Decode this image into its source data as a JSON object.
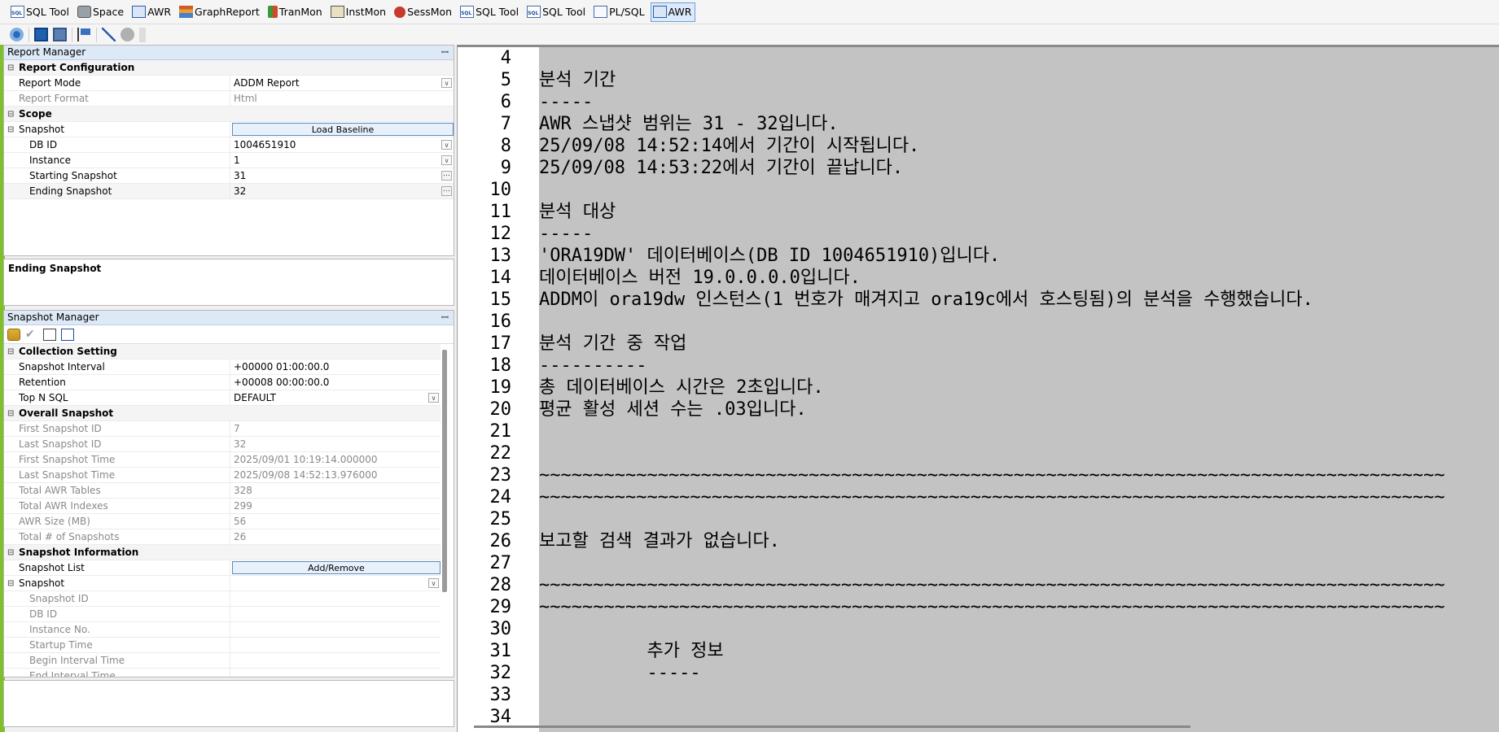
{
  "tabs": [
    {
      "label": "SQL Tool",
      "icon": "sql-tool-icon",
      "cls": "ti-sql"
    },
    {
      "label": "Space",
      "icon": "space-icon",
      "cls": "ti-space"
    },
    {
      "label": "AWR",
      "icon": "awr-icon",
      "cls": "ti-awr"
    },
    {
      "label": "GraphReport",
      "icon": "graph-report-icon",
      "cls": "ti-graph"
    },
    {
      "label": "TranMon",
      "icon": "tranmon-icon",
      "cls": "ti-tran"
    },
    {
      "label": "InstMon",
      "icon": "instmon-icon",
      "cls": "ti-inst"
    },
    {
      "label": "SessMon",
      "icon": "sessmon-icon",
      "cls": "ti-sess"
    },
    {
      "label": "SQL Tool",
      "icon": "sql-tool-icon",
      "cls": "ti-sql"
    },
    {
      "label": "SQL Tool",
      "icon": "sql-tool-icon",
      "cls": "ti-sql"
    },
    {
      "label": "PL/SQL",
      "icon": "plsql-icon",
      "cls": "ti-plsql"
    },
    {
      "label": "AWR",
      "icon": "awr-icon",
      "cls": "ti-awr",
      "active": true
    }
  ],
  "report_manager": {
    "title": "Report Manager",
    "config_section": "Report Configuration",
    "report_mode_label": "Report Mode",
    "report_mode_value": "ADDM Report",
    "report_format_label": "Report Format",
    "report_format_value": "Html",
    "scope_section": "Scope",
    "snapshot_label": "Snapshot",
    "load_baseline_label": "Load Baseline",
    "dbid_label": "DB ID",
    "dbid_value": "1004651910",
    "instance_label": "Instance",
    "instance_value": "1",
    "start_label": "Starting Snapshot",
    "start_value": "31",
    "end_label": "Ending Snapshot",
    "end_value": "32",
    "description_title": "Ending Snapshot"
  },
  "snapshot_manager": {
    "title": "Snapshot Manager",
    "collection_section": "Collection Setting",
    "interval_label": "Snapshot Interval",
    "interval_value": "+00000 01:00:00.0",
    "retention_label": "Retention",
    "retention_value": "+00008 00:00:00.0",
    "topn_label": "Top N SQL",
    "topn_value": "DEFAULT",
    "overall_section": "Overall Snapshot",
    "overall_rows": [
      {
        "label": "First Snapshot ID",
        "value": "7"
      },
      {
        "label": "Last Snapshot ID",
        "value": "32"
      },
      {
        "label": "First Snapshot Time",
        "value": "2025/09/01 10:19:14.000000"
      },
      {
        "label": "Last Snapshot Time",
        "value": "2025/09/08 14:52:13.976000"
      },
      {
        "label": "Total AWR Tables",
        "value": "328"
      },
      {
        "label": "Total AWR Indexes",
        "value": "299"
      },
      {
        "label": "AWR Size (MB)",
        "value": "56"
      },
      {
        "label": "Total # of Snapshots",
        "value": "26"
      }
    ],
    "info_section": "Snapshot Information",
    "snapshot_list_label": "Snapshot List",
    "add_remove_label": "Add/Remove",
    "snapshot_label": "Snapshot",
    "snapshot_fields": [
      "Snapshot ID",
      "DB ID",
      "Instance No.",
      "Startup Time",
      "Begin Interval Time",
      "End Interval Time"
    ]
  },
  "report_lines": [
    {
      "n": "4",
      "t": ""
    },
    {
      "n": "5",
      "t": "분석 기간"
    },
    {
      "n": "6",
      "t": "-----"
    },
    {
      "n": "7",
      "t": "AWR 스냅샷 범위는 31 - 32입니다."
    },
    {
      "n": "8",
      "t": "25/09/08 14:52:14에서 기간이 시작됩니다."
    },
    {
      "n": "9",
      "t": "25/09/08 14:53:22에서 기간이 끝납니다."
    },
    {
      "n": "10",
      "t": ""
    },
    {
      "n": "11",
      "t": "분석 대상"
    },
    {
      "n": "12",
      "t": "-----"
    },
    {
      "n": "13",
      "t": "'ORA19DW' 데이터베이스(DB ID 1004651910)입니다."
    },
    {
      "n": "14",
      "t": "데이터베이스 버전 19.0.0.0.0입니다."
    },
    {
      "n": "15",
      "t": "ADDM이 ora19dw 인스턴스(1 번호가 매겨지고 ora19c에서 호스팅됨)의 분석을 수행했습니다."
    },
    {
      "n": "16",
      "t": ""
    },
    {
      "n": "17",
      "t": "분석 기간 중 작업"
    },
    {
      "n": "18",
      "t": "----------"
    },
    {
      "n": "19",
      "t": "총 데이터베이스 시간은 2초입니다."
    },
    {
      "n": "20",
      "t": "평균 활성 세션 수는 .03입니다."
    },
    {
      "n": "21",
      "t": ""
    },
    {
      "n": "22",
      "t": ""
    },
    {
      "n": "23",
      "t": "~~~~~~~~~~~~~~~~~~~~~~~~~~~~~~~~~~~~~~~~~~~~~~~~~~~~~~~~~~~~~~~~~~~~~~~~~~~~~~~~~~~~"
    },
    {
      "n": "24",
      "t": "~~~~~~~~~~~~~~~~~~~~~~~~~~~~~~~~~~~~~~~~~~~~~~~~~~~~~~~~~~~~~~~~~~~~~~~~~~~~~~~~~~~~"
    },
    {
      "n": "25",
      "t": ""
    },
    {
      "n": "26",
      "t": "보고할 검색 결과가 없습니다."
    },
    {
      "n": "27",
      "t": ""
    },
    {
      "n": "28",
      "t": "~~~~~~~~~~~~~~~~~~~~~~~~~~~~~~~~~~~~~~~~~~~~~~~~~~~~~~~~~~~~~~~~~~~~~~~~~~~~~~~~~~~~"
    },
    {
      "n": "29",
      "t": "~~~~~~~~~~~~~~~~~~~~~~~~~~~~~~~~~~~~~~~~~~~~~~~~~~~~~~~~~~~~~~~~~~~~~~~~~~~~~~~~~~~~"
    },
    {
      "n": "30",
      "t": ""
    },
    {
      "n": "31",
      "t": "          추가 정보"
    },
    {
      "n": "32",
      "t": "          -----"
    },
    {
      "n": "33",
      "t": ""
    },
    {
      "n": "34",
      "t": ""
    }
  ]
}
